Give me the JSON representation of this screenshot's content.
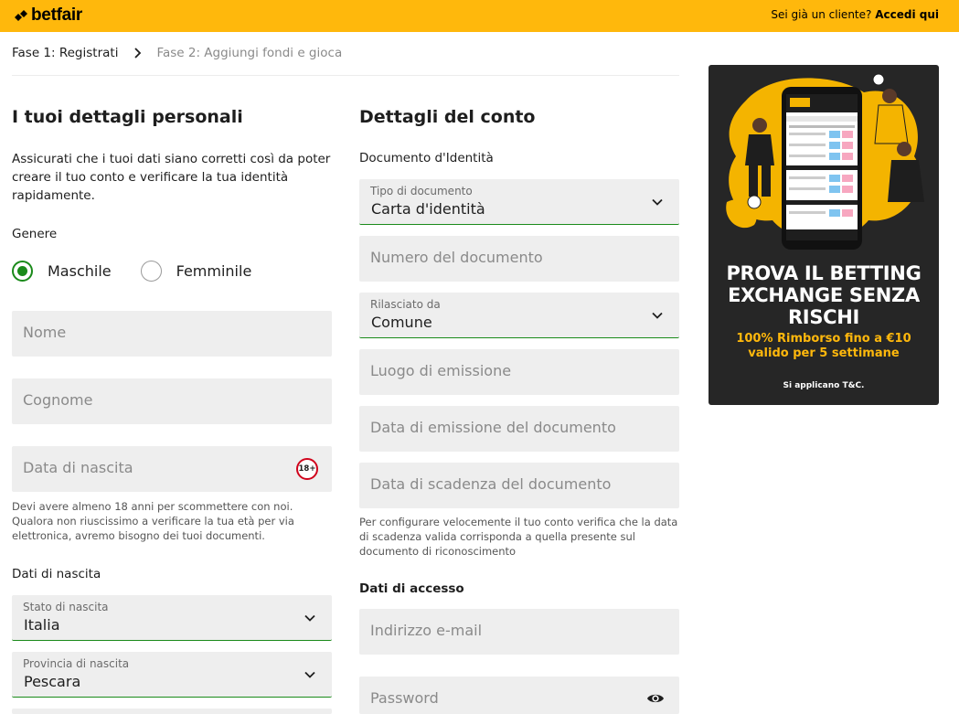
{
  "header": {
    "logo_text": "betfair",
    "login_prompt": "Sei già un cliente?",
    "login_link": "Accedi qui",
    "brand_color": "#ffb80c"
  },
  "breadcrumb": {
    "step1": "Fase 1: Registrati",
    "separator_icon": "chevron-right-icon",
    "step2": "Fase 2: Aggiungi fondi e gioca"
  },
  "personal": {
    "title": "I tuoi dettagli personali",
    "intro": "Assicurati che i tuoi dati siano corretti così da poter creare il tuo conto e verificare la tua identità rapidamente.",
    "gender_label": "Genere",
    "gender_options": [
      {
        "label": "Maschile",
        "selected": true
      },
      {
        "label": "Femminile",
        "selected": false
      }
    ],
    "first_name_placeholder": "Nome",
    "last_name_placeholder": "Cognome",
    "dob_placeholder": "Data di nascita",
    "age_badge": "18+",
    "age_note": "Devi avere almeno 18 anni per scommettere con noi. Qualora non riuscissimo a verificare la tua età per via elettronica, avremo bisogno dei tuoi documenti.",
    "birth_data_label": "Dati di nascita",
    "birth_country": {
      "label": "Stato di nascita",
      "value": "Italia"
    },
    "birth_province": {
      "label": "Provincia di nascita",
      "value": "Pescara"
    }
  },
  "account": {
    "title": "Dettagli del conto",
    "id_doc_label": "Documento d'Identità",
    "doc_type": {
      "label": "Tipo di documento",
      "value": "Carta d'identità"
    },
    "doc_number_placeholder": "Numero del documento",
    "issued_by": {
      "label": "Rilasciato da",
      "value": "Comune"
    },
    "issue_place_placeholder": "Luogo di emissione",
    "issue_date_placeholder": "Data di emissione del documento",
    "expiry_date_placeholder": "Data di scadenza del documento",
    "expiry_note": "Per configurare velocemente il tuo conto verifica che la data di scadenza valida corrisponda a quella presente sul documento di riconoscimento",
    "access_label": "Dati di accesso",
    "email_placeholder": "Indirizzo e-mail",
    "password_placeholder": "Password"
  },
  "promo": {
    "headline_lines": [
      "PROVA IL BETTING",
      "EXCHANGE SENZA",
      "RISCHI"
    ],
    "sub_lines": [
      "100% Rimborso fino a €10",
      "valido per 5 settimane"
    ],
    "terms": "Si applicano T&C."
  }
}
